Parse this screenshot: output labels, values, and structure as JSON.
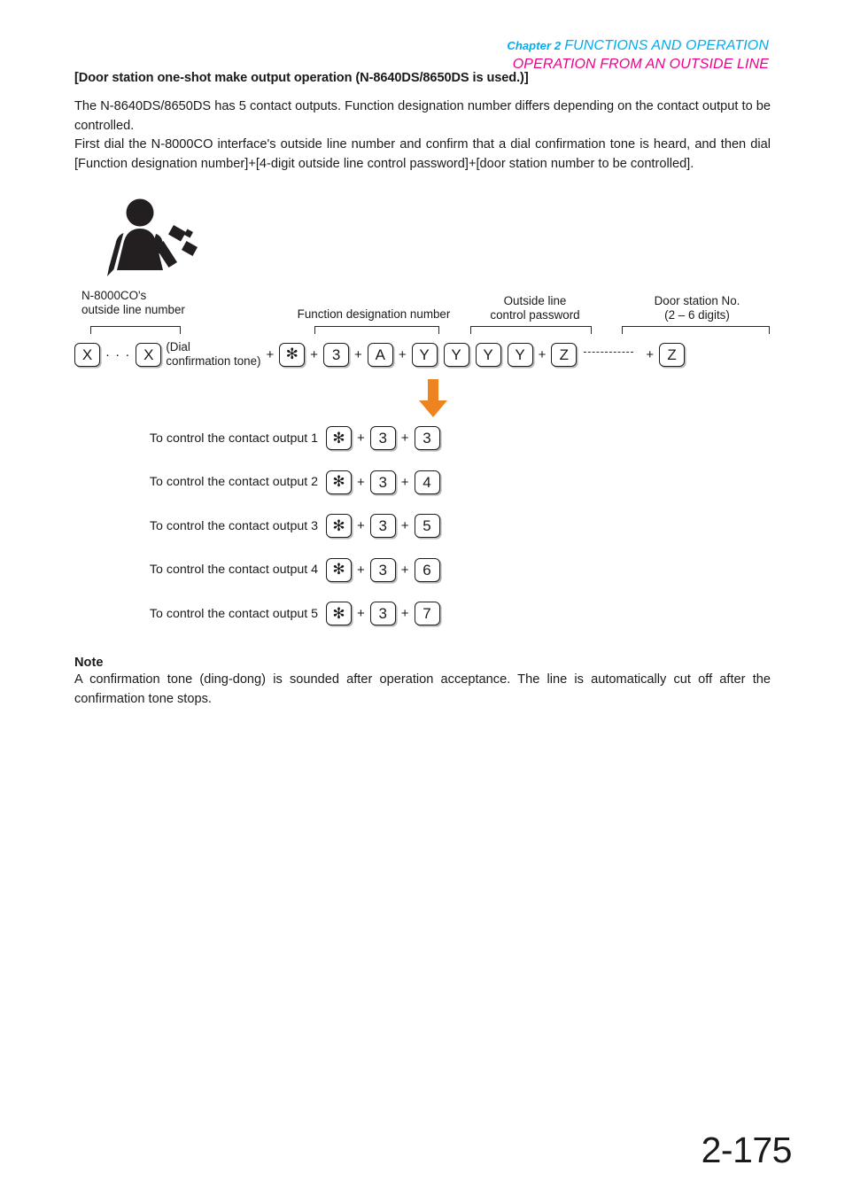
{
  "header": {
    "chapter_label": "Chapter 2",
    "chapter_title": "FUNCTIONS AND OPERATION",
    "subtitle": "OPERATION FROM AN OUTSIDE LINE",
    "chapter_color": "#00AEEF",
    "subtitle_color": "#EC008C"
  },
  "section": {
    "heading": "[Door station one-shot make output operation (N-8640DS/8650DS is used.)]",
    "paragraph_1": "The N-8640DS/8650DS has 5 contact outputs. Function designation number differs depending on the contact output to be controlled.",
    "paragraph_2": "First dial the N-8000CO interface's outside line number and confirm that a dial confirmation tone is heard, and then dial [Function designation number]+[4-digit outside line control password]+[door station number to be controlled]."
  },
  "figure": {
    "person_icon_name": "person-on-telephone-icon",
    "arrow_color": "#EE8420",
    "groups": {
      "outside_line_number": "N-8000CO's\noutside line number",
      "outside_line_number_l1": "N-8000CO's",
      "outside_line_number_l2": "outside line number",
      "function_designation": "Function designation number",
      "control_password_l1": "Outside line",
      "control_password_l2": "control password",
      "door_station_l1": "Door station No.",
      "door_station_l2": "(2 – 6 digits)"
    },
    "dial_sequence": {
      "key_x1": "X",
      "dots": "·  ·  ·",
      "key_x2": "X",
      "dial_tone_note_l1": "(Dial",
      "dial_tone_note_l2": "confirmation tone)",
      "plus": "+",
      "key_asterisk": "✻",
      "key_3": "3",
      "key_a": "A",
      "key_y1": "Y",
      "key_y2": "Y",
      "key_y3": "Y",
      "key_y4": "Y",
      "key_z1": "Z",
      "key_z2": "Z"
    },
    "outputs": [
      {
        "label": "To control the contact output 1",
        "k1": "✻",
        "k2": "3",
        "k3": "3"
      },
      {
        "label": "To control the contact output 2",
        "k1": "✻",
        "k2": "3",
        "k3": "4"
      },
      {
        "label": "To control the contact output 3",
        "k1": "✻",
        "k2": "3",
        "k3": "5"
      },
      {
        "label": "To control the contact output 4",
        "k1": "✻",
        "k2": "3",
        "k3": "6"
      },
      {
        "label": "To control the contact output 5",
        "k1": "✻",
        "k2": "3",
        "k3": "7"
      }
    ]
  },
  "note": {
    "title": "Note",
    "body": "A confirmation tone (ding-dong) is sounded after operation acceptance. The line is automatically cut off after the confirmation tone stops."
  },
  "footer": {
    "page_number": "2-175"
  }
}
